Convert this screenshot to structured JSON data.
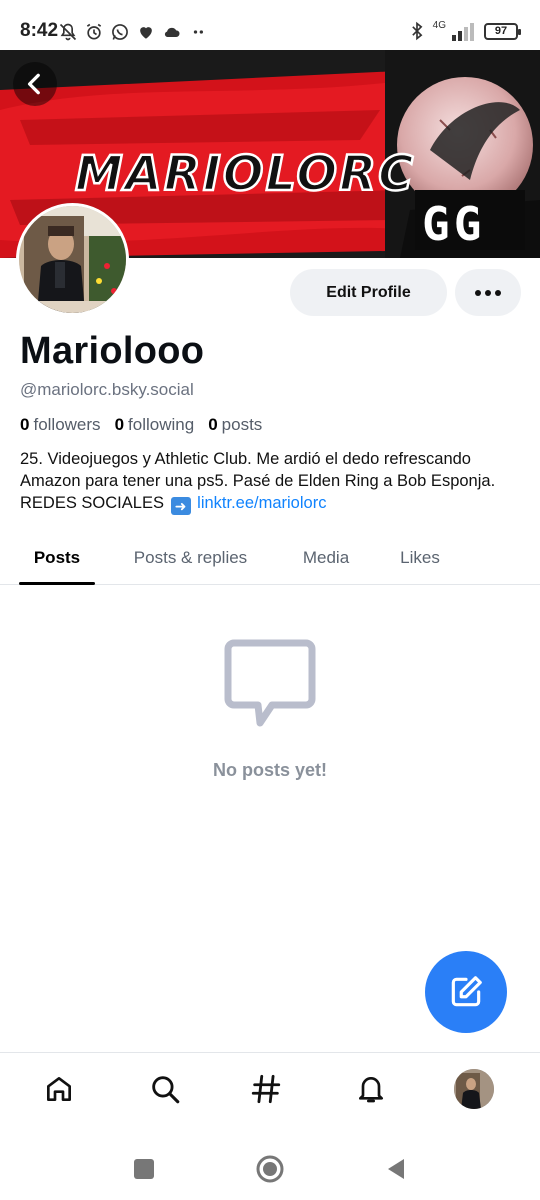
{
  "status_bar": {
    "time": "8:42",
    "battery": "97",
    "network": "4G",
    "icons_left": [
      "mute-icon",
      "alarm-icon",
      "whatsapp-icon",
      "heart-icon",
      "cloud-icon",
      "more-dots-icon"
    ],
    "icons_right": [
      "bluetooth-icon",
      "signal-icon",
      "battery-icon"
    ]
  },
  "banner": {
    "title_text": "MARIOLORC",
    "badge_text": "GG"
  },
  "actions": {
    "edit_label": "Edit Profile"
  },
  "profile": {
    "display_name": "Mariolooo",
    "handle": "@mariolorc.bsky.social",
    "stats": [
      {
        "value": "0",
        "label": "followers"
      },
      {
        "value": "0",
        "label": "following"
      },
      {
        "value": "0",
        "label": "posts"
      }
    ],
    "bio_text": "25. Videojuegos y Athletic Club. Me ardió el dedo refrescando Amazon para tener una ps5. Pasé de Elden Ring a Bob Esponja. REDES SOCIALES",
    "bio_link": "linktr.ee/mariolorc"
  },
  "tabs": [
    {
      "label": "Posts",
      "active": true
    },
    {
      "label": "Posts & replies",
      "active": false
    },
    {
      "label": "Media",
      "active": false
    },
    {
      "label": "Likes",
      "active": false
    }
  ],
  "empty_state": {
    "message": "No posts yet!"
  },
  "bottom_nav": [
    "home-icon",
    "search-icon",
    "hashtag-icon",
    "notifications-icon",
    "profile-avatar"
  ],
  "colors": {
    "accent": "#2a7ff7",
    "link": "#1083fe",
    "banner_red": "#c80f14",
    "muted_text": "#6b7280"
  }
}
